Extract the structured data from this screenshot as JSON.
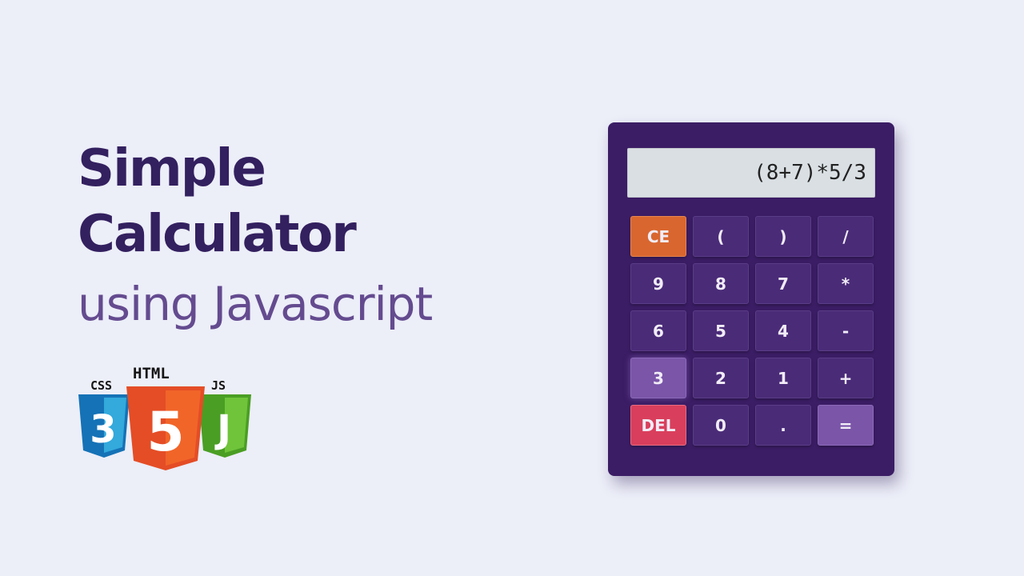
{
  "heading": {
    "line1": "Simple",
    "line2": "Calculator",
    "line3": "using Javascript"
  },
  "logos": {
    "css": {
      "label": "CSS",
      "glyph": "3",
      "color": "#1572b6",
      "icon": "css3-shield-icon"
    },
    "html": {
      "label": "HTML",
      "glyph": "5",
      "color": "#e44d26",
      "icon": "html5-shield-icon"
    },
    "js": {
      "label": "JS",
      "glyph": "J",
      "color": "#5cb82f",
      "icon": "js-shield-icon"
    }
  },
  "calculator": {
    "display": "(8+7)*5/3",
    "keys": [
      {
        "label": "CE",
        "name": "clear-entry-button",
        "style": "ce"
      },
      {
        "label": "(",
        "name": "open-paren-button",
        "style": ""
      },
      {
        "label": ")",
        "name": "close-paren-button",
        "style": ""
      },
      {
        "label": "/",
        "name": "divide-button",
        "style": ""
      },
      {
        "label": "9",
        "name": "digit-9-button",
        "style": ""
      },
      {
        "label": "8",
        "name": "digit-8-button",
        "style": ""
      },
      {
        "label": "7",
        "name": "digit-7-button",
        "style": ""
      },
      {
        "label": "*",
        "name": "multiply-button",
        "style": ""
      },
      {
        "label": "6",
        "name": "digit-6-button",
        "style": ""
      },
      {
        "label": "5",
        "name": "digit-5-button",
        "style": ""
      },
      {
        "label": "4",
        "name": "digit-4-button",
        "style": ""
      },
      {
        "label": "-",
        "name": "subtract-button",
        "style": ""
      },
      {
        "label": "3",
        "name": "digit-3-button",
        "style": "active"
      },
      {
        "label": "2",
        "name": "digit-2-button",
        "style": ""
      },
      {
        "label": "1",
        "name": "digit-1-button",
        "style": ""
      },
      {
        "label": "+",
        "name": "add-button",
        "style": ""
      },
      {
        "label": "DEL",
        "name": "delete-button",
        "style": "del"
      },
      {
        "label": "0",
        "name": "digit-0-button",
        "style": ""
      },
      {
        "label": ".",
        "name": "decimal-point-button",
        "style": ""
      },
      {
        "label": "=",
        "name": "equals-button",
        "style": "eq"
      }
    ]
  },
  "colors": {
    "background": "#eceef8",
    "heading_dark": "#33205f",
    "heading_light": "#644b8f",
    "calculator_body": "#3b1d65",
    "key": "#4a2b78",
    "key_ce": "#d9662f",
    "key_del": "#d93f5c",
    "key_eq": "#7a55a8"
  }
}
